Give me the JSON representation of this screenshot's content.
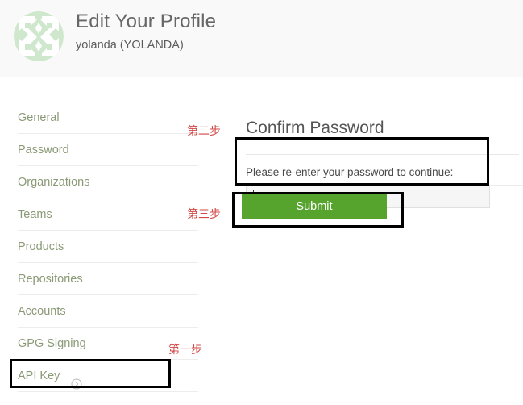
{
  "header": {
    "title": "Edit Your Profile",
    "subtitle": "yolanda (YOLANDA)",
    "avatar_icon": "identicon-avatar",
    "avatar_color": "#cfe8cd"
  },
  "sidebar": {
    "items": [
      {
        "label": "General",
        "icon": null
      },
      {
        "label": "Password",
        "icon": null
      },
      {
        "label": "Organizations",
        "icon": null
      },
      {
        "label": "Teams",
        "icon": null
      },
      {
        "label": "Products",
        "icon": null
      },
      {
        "label": "Repositories",
        "icon": null
      },
      {
        "label": "Accounts",
        "icon": null
      },
      {
        "label": "GPG Signing",
        "icon": null
      },
      {
        "label": "API Key",
        "icon": "circle-chevron-right-icon"
      }
    ],
    "link_color": "#8a9a76"
  },
  "main": {
    "section_title": "Confirm Password",
    "password_label": "Please re-enter your password to continue:",
    "password_value": "",
    "password_placeholder": "",
    "submit_label": "Submit",
    "submit_color": "#56a32e"
  },
  "annotations": {
    "color": "#d34747",
    "box_color": "#000000",
    "steps": [
      {
        "id": "step-1",
        "text": "第一步",
        "target": "API Key"
      },
      {
        "id": "step-2",
        "text": "第二步",
        "target": "Password field"
      },
      {
        "id": "step-3",
        "text": "第三步",
        "target": "Submit button"
      }
    ]
  }
}
